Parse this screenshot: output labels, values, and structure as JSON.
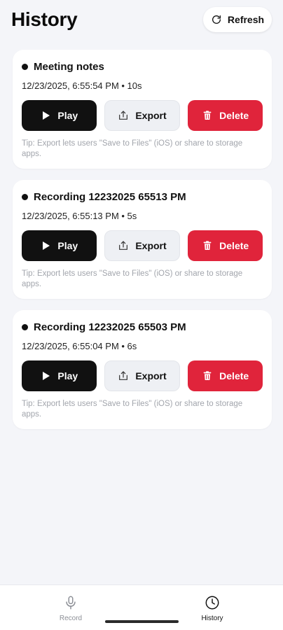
{
  "header": {
    "title": "History",
    "refresh_label": "Refresh"
  },
  "recordings": [
    {
      "title": "Meeting notes",
      "meta": "12/23/2025, 6:55:54 PM • 10s",
      "play_label": "Play",
      "export_label": "Export",
      "delete_label": "Delete",
      "tip": "Tip: Export lets users \"Save to Files\" (iOS) or share to storage apps."
    },
    {
      "title": "Recording 12232025 65513 PM",
      "meta": "12/23/2025, 6:55:13 PM • 5s",
      "play_label": "Play",
      "export_label": "Export",
      "delete_label": "Delete",
      "tip": "Tip: Export lets users \"Save to Files\" (iOS) or share to storage apps."
    },
    {
      "title": "Recording 12232025 65503 PM",
      "meta": "12/23/2025, 6:55:04 PM • 6s",
      "play_label": "Play",
      "export_label": "Export",
      "delete_label": "Delete",
      "tip": "Tip: Export lets users \"Save to Files\" (iOS) or share to storage apps."
    }
  ],
  "nav": {
    "record_label": "Record",
    "history_label": "History",
    "active": "history"
  },
  "icons": {
    "refresh": "refresh-icon",
    "play": "play-icon",
    "export": "share-icon",
    "delete": "trash-icon",
    "record": "microphone-icon",
    "history": "clock-icon"
  },
  "colors": {
    "background": "#f4f5f9",
    "primary": "#111111",
    "danger": "#e0243b",
    "secondary_button": "#eef0f4",
    "muted_text": "#a2a5ac"
  }
}
